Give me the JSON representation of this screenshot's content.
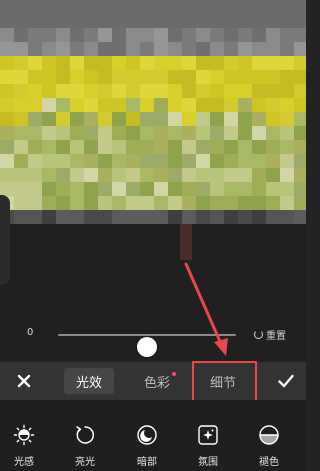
{
  "editor": {
    "slider": {
      "value_label": "0",
      "level": 0.5
    },
    "reset_label": "重置",
    "tabs": {
      "effects": "光效",
      "color": "色彩",
      "detail": "细节"
    },
    "active_tab": "effects",
    "highlighted_tab": "detail",
    "icons": {
      "close": "close-icon",
      "confirm": "check-icon",
      "reset": "reset-icon"
    },
    "tools": [
      {
        "label": "光感",
        "icon": "sun-icon"
      },
      {
        "label": "亮光",
        "icon": "rotate-icon"
      },
      {
        "label": "暗部",
        "icon": "moon-icon"
      },
      {
        "label": "氛围",
        "icon": "sparkle-icon"
      },
      {
        "label": "褪色",
        "icon": "fade-icon"
      }
    ]
  },
  "colors": {
    "background": "#232323",
    "tab_bar": "#333333",
    "annotation_red": "#e7474d",
    "color_tab_dot": "#ff4a6a"
  }
}
